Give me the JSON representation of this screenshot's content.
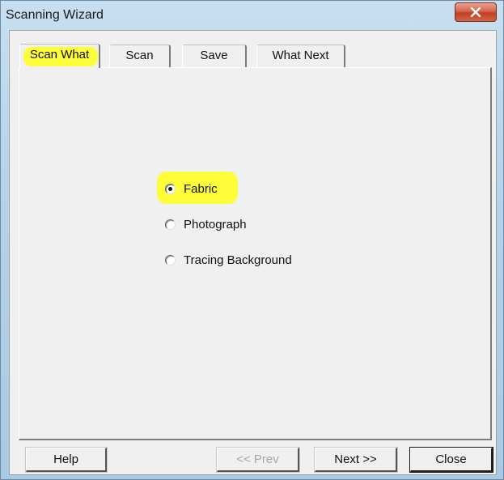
{
  "window": {
    "title": "Scanning Wizard"
  },
  "tabs": [
    {
      "label": "Scan What",
      "active": true
    },
    {
      "label": "Scan",
      "active": false
    },
    {
      "label": "Save",
      "active": false
    },
    {
      "label": "What Next",
      "active": false
    }
  ],
  "options": [
    {
      "label": "Fabric",
      "selected": true
    },
    {
      "label": "Photograph",
      "selected": false
    },
    {
      "label": "Tracing Background",
      "selected": false
    }
  ],
  "buttons": {
    "help": "Help",
    "prev": "<< Prev",
    "next": "Next >>",
    "close": "Close"
  },
  "colors": {
    "highlight": "#fdfd3a",
    "titlebar": "#b5d3ea",
    "close_button": "#c1401f",
    "dialog_face": "#f0f0f0"
  },
  "icons": {
    "close": "close-icon"
  }
}
